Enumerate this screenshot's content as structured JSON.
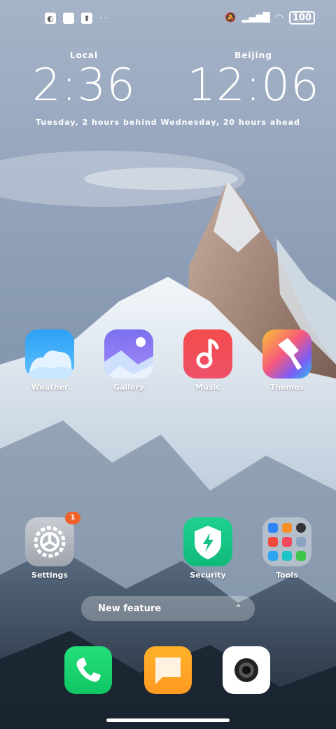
{
  "status_bar": {
    "left_icons": [
      "app-notification-icon",
      "square-icon",
      "upload-icon"
    ],
    "more": "··",
    "right_icons": [
      "mute-icon",
      "signal-icon",
      "wifi-icon"
    ],
    "battery": "100"
  },
  "clocks": [
    {
      "city": "Local",
      "time": "2:36"
    },
    {
      "city": "Beijing",
      "time": "12:06"
    }
  ],
  "clock_diff": "Tuesday, 2 hours behind  Wednesday, 20 hours ahead",
  "apps_row1": [
    {
      "label": "Weather",
      "icon": "weather-icon"
    },
    {
      "label": "Gallery",
      "icon": "gallery-icon"
    },
    {
      "label": "Music",
      "icon": "music-icon"
    },
    {
      "label": "Themes",
      "icon": "themes-icon"
    }
  ],
  "apps_row2": [
    {
      "label": "Settings",
      "icon": "settings-icon",
      "badge": "1"
    },
    {
      "label": "Security",
      "icon": "security-icon"
    },
    {
      "label": "Tools",
      "icon": "tools-folder-icon"
    }
  ],
  "pill": {
    "label": "New feature"
  },
  "dock": [
    {
      "label": "Phone",
      "icon": "phone-icon"
    },
    {
      "label": "Messages",
      "icon": "messages-icon"
    },
    {
      "label": "Camera",
      "icon": "camera-icon"
    }
  ]
}
